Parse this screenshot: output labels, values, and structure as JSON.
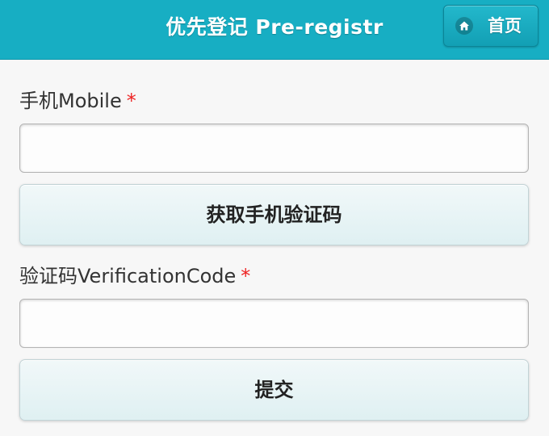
{
  "header": {
    "title": "优先登记 Pre-registr",
    "home_icon": "home-icon",
    "home_label": "首页",
    "color": "#17aec3"
  },
  "form": {
    "mobile": {
      "label": "手机Mobile",
      "required_mark": "*",
      "value": "",
      "placeholder": ""
    },
    "get_code_button": "获取手机验证码",
    "verification": {
      "label": "验证码VerificationCode",
      "required_mark": "*",
      "value": "",
      "placeholder": ""
    },
    "submit_button": "提交"
  }
}
